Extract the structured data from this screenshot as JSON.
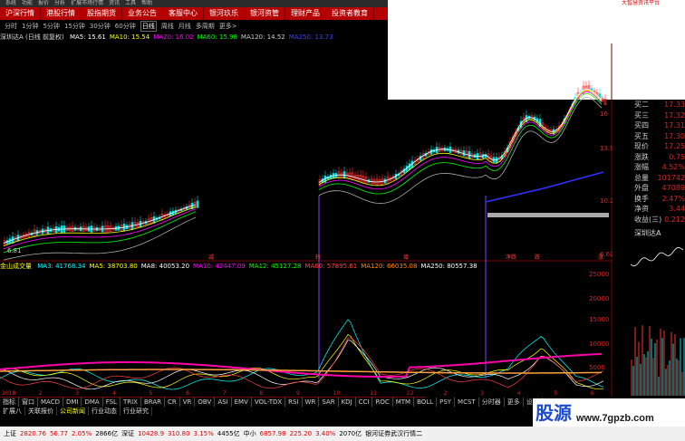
{
  "topbar": {
    "items": [
      "系统",
      "功能",
      "报价",
      "分析",
      "扩展市场行情",
      "资讯",
      "工具",
      "帮助"
    ],
    "right_text": "大智慧资讯平台"
  },
  "nav": {
    "items": [
      "沪深行情",
      "港股行情",
      "股指期货",
      "业务公告",
      "客服中心",
      "银河玖乐",
      "银河资管",
      "理财产品",
      "投资者教育"
    ]
  },
  "periods": {
    "items": [
      "分时",
      "1分钟",
      "5分钟",
      "15分钟",
      "30分钟",
      "60分钟",
      "日线",
      "周线",
      "月线",
      "多周期",
      "更多>"
    ],
    "active_index": 6
  },
  "ma_line": {
    "title": "深圳达A (日线 前复权)",
    "items": [
      {
        "text": "MA5: 15.61",
        "color": "#ffffff"
      },
      {
        "text": "MA10: 15.54",
        "color": "#ffff00"
      },
      {
        "text": "MA20: 16.02",
        "color": "#ff00ff"
      },
      {
        "text": "MA60: 15.98",
        "color": "#00ff00"
      },
      {
        "text": "MA120: 14.52",
        "color": "#cccccc"
      },
      {
        "text": "MA250: 13.73",
        "color": "#4040ff"
      }
    ]
  },
  "vol_line": {
    "title": "金山成交量",
    "items": [
      {
        "text": "MA3: 41768.34",
        "color": "#00ffff"
      },
      {
        "text": "MA5: 38703.80",
        "color": "#ffff00"
      },
      {
        "text": "MA8: 40053.20",
        "color": "#ffffff"
      },
      {
        "text": "MA10: 42447.09",
        "color": "#ff00ff"
      },
      {
        "text": "MA12: 45127.28",
        "color": "#00ff00"
      },
      {
        "text": "MA60: 57895.61",
        "color": "#ff4040"
      },
      {
        "text": "MA120: 66035.08",
        "color": "#ff8800"
      },
      {
        "text": "MA250: 80557.38",
        "color": "#ffffff"
      }
    ]
  },
  "price_axis": {
    "labels": [
      "16",
      "13.92",
      "10.22",
      "6.62"
    ]
  },
  "vol_axis": {
    "labels": [
      "25000",
      "20000",
      "15000",
      "10000",
      "5000"
    ]
  },
  "low_label": "6.81",
  "markers": {
    "items": [
      "减",
      "转",
      "增",
      "净跌",
      "跌",
      "涨"
    ]
  },
  "quote": {
    "rows": [
      {
        "label": "买二",
        "value": "17.33"
      },
      {
        "label": "买三",
        "value": "17.32"
      },
      {
        "label": "买四",
        "value": "17.31"
      },
      {
        "label": "买五",
        "value": "17.30"
      },
      {
        "label": "现价",
        "value": "17.25"
      },
      {
        "label": "涨跌",
        "value": "0.75"
      },
      {
        "label": "涨幅",
        "value": "4.52%"
      },
      {
        "label": "总量",
        "value": "101742"
      },
      {
        "label": "外盘",
        "value": "47089"
      },
      {
        "label": "换手",
        "value": "2.47%"
      },
      {
        "label": "净资",
        "value": "3.44"
      },
      {
        "label": "收益(三)",
        "value": "0.212"
      }
    ],
    "stock_name": "深圳达A"
  },
  "timeline": {
    "labels": [
      "2018",
      "2",
      "3",
      "4",
      "5",
      "6",
      "7",
      "8",
      "9",
      "10",
      "11",
      "12",
      "2",
      "3",
      "4",
      "5",
      "6"
    ],
    "right_tab": "日线"
  },
  "tabs": {
    "items": [
      "指标",
      "窗口",
      "MACD",
      "DMI",
      "DMA",
      "FSL",
      "TRIX",
      "BRAR",
      "CR",
      "VR",
      "OBV",
      "ASI",
      "EMV",
      "VOL-TDX",
      "RSI",
      "WR",
      "SAR",
      "KDJ",
      "CCI",
      "ROC",
      "MTM",
      "BOLL",
      "PSY",
      "MCST",
      "分时器",
      "更多",
      "设置"
    ]
  },
  "infotabs": {
    "items": [
      "扩展八",
      "关联报价",
      "公司新闻",
      "行业动态",
      "行业研究"
    ],
    "active_index": 2
  },
  "status": {
    "items": [
      {
        "name": "上证",
        "value": "2820.76",
        "chg": "56.77",
        "pct": "2.05%",
        "amt": "2866亿"
      },
      {
        "name": "深证",
        "value": "10428.9",
        "chg": "310.80",
        "pct": "3.15%",
        "amt": "4455亿"
      },
      {
        "name": "中小",
        "value": "6857.98",
        "chg": "225.20",
        "pct": "3.40%",
        "amt": "2070亿"
      }
    ],
    "broker": "银河证券武汉行情二"
  },
  "watermark": {
    "logo": "股源",
    "url": "www.7gpzb.com"
  },
  "colors": {
    "red": "#b40000",
    "up": "#e02020",
    "down": "#00ffff"
  }
}
